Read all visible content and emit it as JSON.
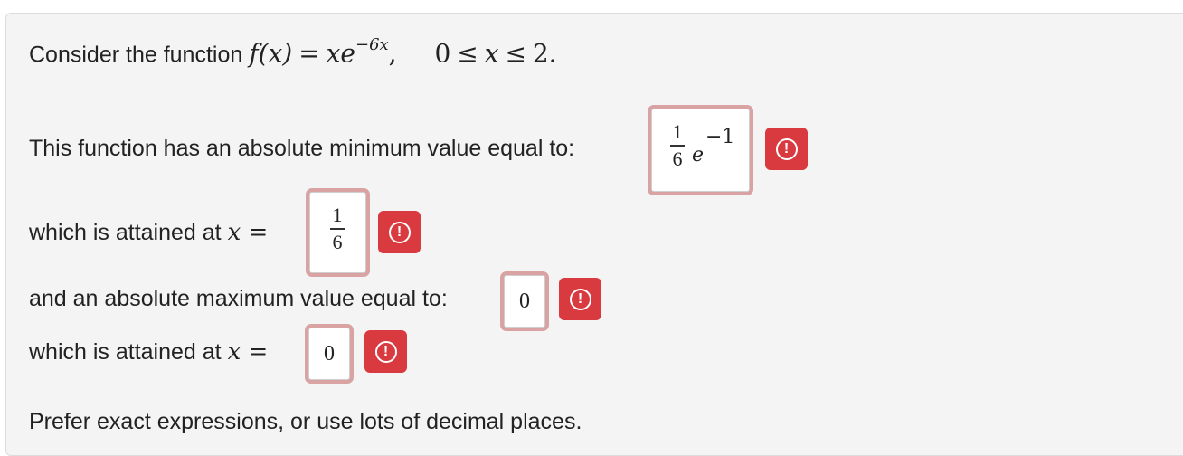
{
  "question": {
    "intro_text": "Consider the function",
    "function": {
      "lhs": "f(x)",
      "eq": "=",
      "rhs_base": "xe",
      "rhs_exp": "−6x",
      "comma": ","
    },
    "domain": {
      "lower": "0",
      "le1": "≤",
      "var": "x",
      "le2": "≤",
      "upper": "2."
    },
    "min_value_label": "This function has an absolute minimum value equal to:",
    "min_value_answer": {
      "num": "1",
      "den": "6",
      "base": "e",
      "exp": "−1"
    },
    "min_at_label": "which is attained at",
    "min_at_var": "x =",
    "min_at_answer": {
      "num": "1",
      "den": "6"
    },
    "max_value_label": "and an absolute maximum value equal to:",
    "max_value_answer": "0",
    "max_at_label": "which is attained at",
    "max_at_var": "x =",
    "max_at_answer": "0",
    "footer_text": "Prefer exact expressions, or use lots of decimal places."
  },
  "warning_icon": "exclamation-circle-icon",
  "colors": {
    "warning_bg": "#d83a3f",
    "answer_border": "#d9a3a4",
    "panel_bg": "#f4f4f4"
  }
}
